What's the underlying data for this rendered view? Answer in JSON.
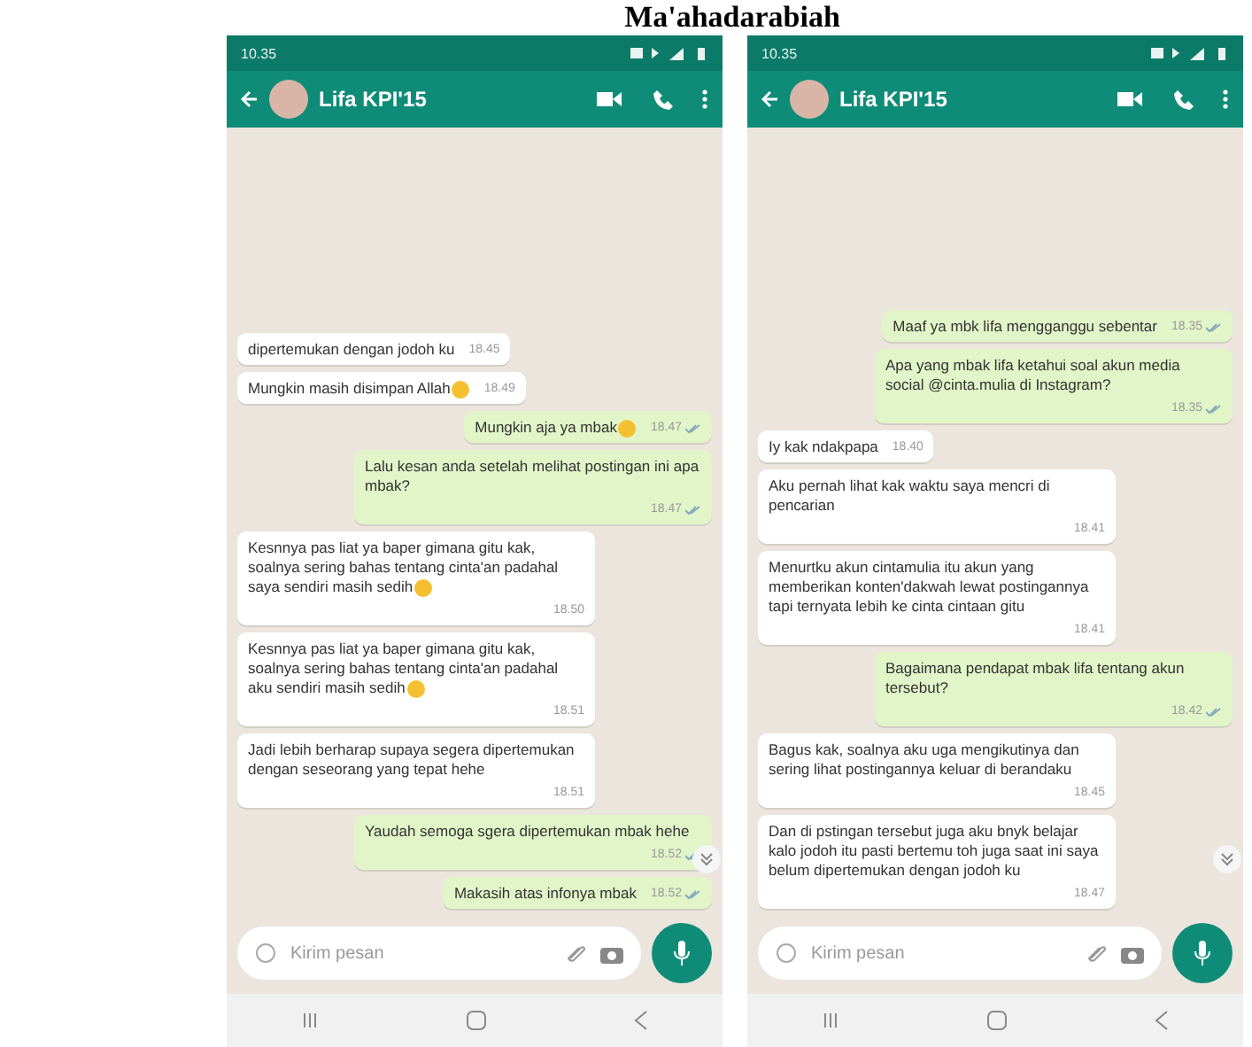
{
  "page_heading": "Ma'ahadarabiah",
  "phones": [
    {
      "status_time": "10.35",
      "contact": "Lifa KPI'15",
      "placeholder": "Kirim pesan",
      "messages": [
        {
          "kind": "in",
          "text": "dipertemukan dengan jodoh ku",
          "time": "18.45",
          "emoji": false
        },
        {
          "kind": "in",
          "text": "Mungkin masih disimpan Allah",
          "time": "18.49",
          "emoji": true
        },
        {
          "kind": "out",
          "text": "Mungkin aja ya mbak",
          "time": "18.47",
          "emoji": true
        },
        {
          "kind": "out",
          "text": "Lalu kesan anda setelah melihat postingan ini apa mbak?",
          "time": "18.47",
          "emoji": false
        },
        {
          "kind": "in",
          "text": "Kesnnya pas liat ya baper gimana gitu kak, soalnya sering bahas tentang cinta'an padahal saya sendiri masih sedih",
          "time": "18.50",
          "emoji": true
        },
        {
          "kind": "in",
          "text": "Kesnnya pas liat ya baper gimana gitu kak, soalnya sering bahas tentang cinta'an padahal aku sendiri masih sedih",
          "time": "18.51",
          "emoji": true
        },
        {
          "kind": "in",
          "text": "Jadi lebih berharap supaya segera dipertemukan dengan seseorang yang tepat hehe",
          "time": "18.51",
          "emoji": false
        },
        {
          "kind": "out",
          "text": "Yaudah semoga sgera dipertemukan mbak hehe",
          "time": "18.52",
          "emoji": false
        },
        {
          "kind": "out",
          "text": "Makasih atas infonya mbak",
          "time": "18.52",
          "emoji": false
        }
      ]
    },
    {
      "status_time": "10.35",
      "contact": "Lifa KPI'15",
      "placeholder": "Kirim pesan",
      "messages": [
        {
          "kind": "out",
          "text": "Maaf ya mbk lifa mengganggu sebentar",
          "time": "18.35",
          "emoji": false
        },
        {
          "kind": "out",
          "text": "Apa yang mbak lifa ketahui soal akun media social @cinta.mulia di Instagram?",
          "time": "18.35",
          "emoji": false
        },
        {
          "kind": "in",
          "text": "Iy kak ndakpapa",
          "time": "18.40",
          "emoji": false
        },
        {
          "kind": "in",
          "text": "Aku pernah lihat kak waktu saya mencri di pencarian",
          "time": "18.41",
          "emoji": false
        },
        {
          "kind": "in",
          "text": "Menurtku akun cintamulia itu akun yang memberikan konten'dakwah lewat postingannya tapi ternyata lebih ke cinta cintaan gitu",
          "time": "18.41",
          "emoji": false
        },
        {
          "kind": "out",
          "text": "Bagaimana pendapat mbak lifa tentang akun tersebut?",
          "time": "18.42",
          "emoji": false
        },
        {
          "kind": "in",
          "text": "Bagus kak, soalnya aku uga mengikutinya dan sering lihat postingannya keluar di berandaku",
          "time": "18.45",
          "emoji": false
        },
        {
          "kind": "in",
          "text": "Dan di pstingan tersebut juga aku bnyk belajar kalo jodoh itu pasti bertemu toh juga saat ini saya belum dipertemukan dengan jodoh ku",
          "time": "18.47",
          "emoji": false
        }
      ]
    }
  ]
}
